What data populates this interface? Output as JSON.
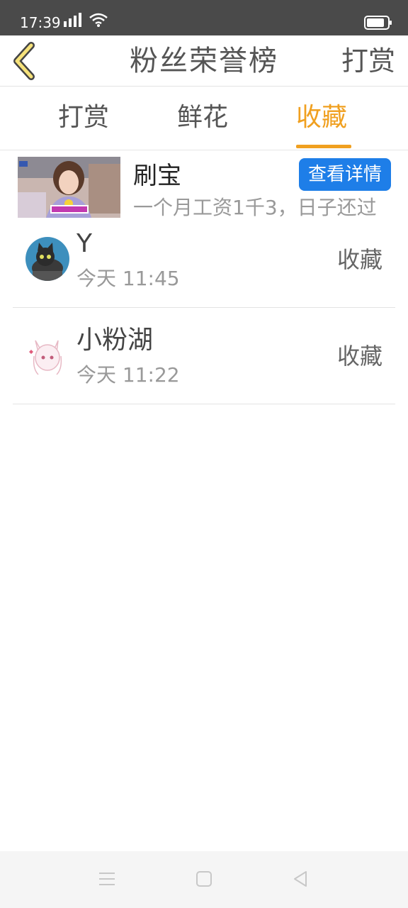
{
  "status_bar": {
    "time": "17:39",
    "icons": [
      "signal-icon",
      "wifi-icon",
      "battery-icon"
    ]
  },
  "header": {
    "title": "粉丝荣誉榜",
    "action": "打赏"
  },
  "tabs": [
    {
      "label": "打赏",
      "active": false
    },
    {
      "label": "鲜花",
      "active": false
    },
    {
      "label": "收藏",
      "active": true
    }
  ],
  "promo": {
    "title": "刷宝",
    "description": "一个月工资1千3，日子还过",
    "button": "查看详情"
  },
  "list": [
    {
      "name": "Y",
      "time": "今天 11:45",
      "action": "收藏"
    },
    {
      "name": "小粉湖",
      "time": "今天 11:22",
      "action": "收藏"
    }
  ],
  "colors": {
    "accent": "#f0a020",
    "button_blue": "#1e7ee8",
    "status_bar": "#4a4a4a"
  }
}
